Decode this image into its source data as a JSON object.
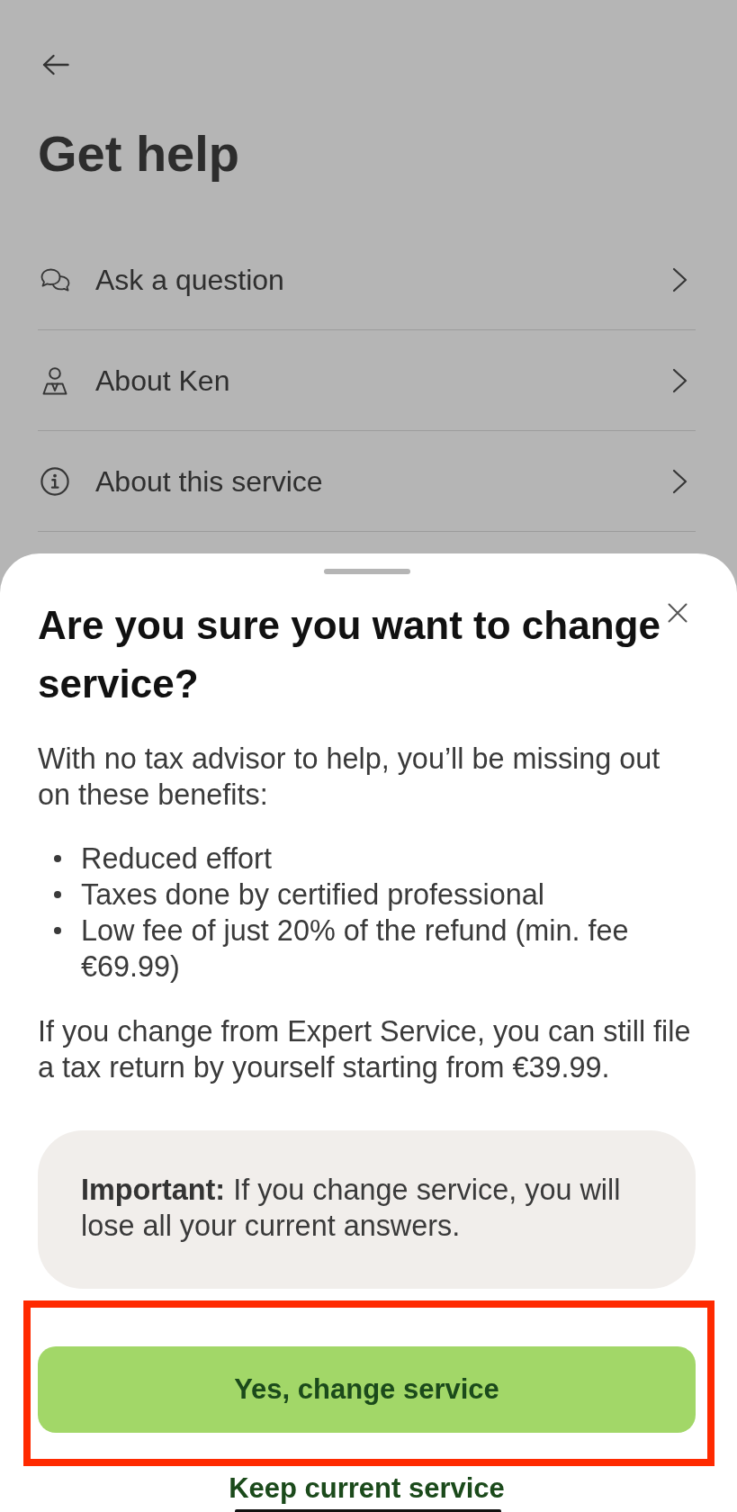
{
  "page": {
    "title": "Get help",
    "menu_items": [
      {
        "kind": "chat",
        "label": "Ask a question"
      },
      {
        "kind": "advisor",
        "label": "About Ken"
      },
      {
        "kind": "info",
        "label": "About this service"
      }
    ]
  },
  "sheet": {
    "title": "Are you sure you want to change service?",
    "intro": "With no tax advisor to help, you’ll be missing out on these benefits:",
    "benefits": [
      "Reduced effort",
      "Taxes done by certified professional",
      "Low fee of just 20% of the refund (min. fee €69.99)"
    ],
    "outro": "If you change from Expert Service, you can still file a tax return by yourself starting from €39.99.",
    "note": "**Important:** If you change service, you will lose all your current answers.",
    "primary_button": {
      "label": "Yes, change service",
      "highlighted": true
    },
    "secondary_button": {
      "label": "Keep current service"
    }
  }
}
